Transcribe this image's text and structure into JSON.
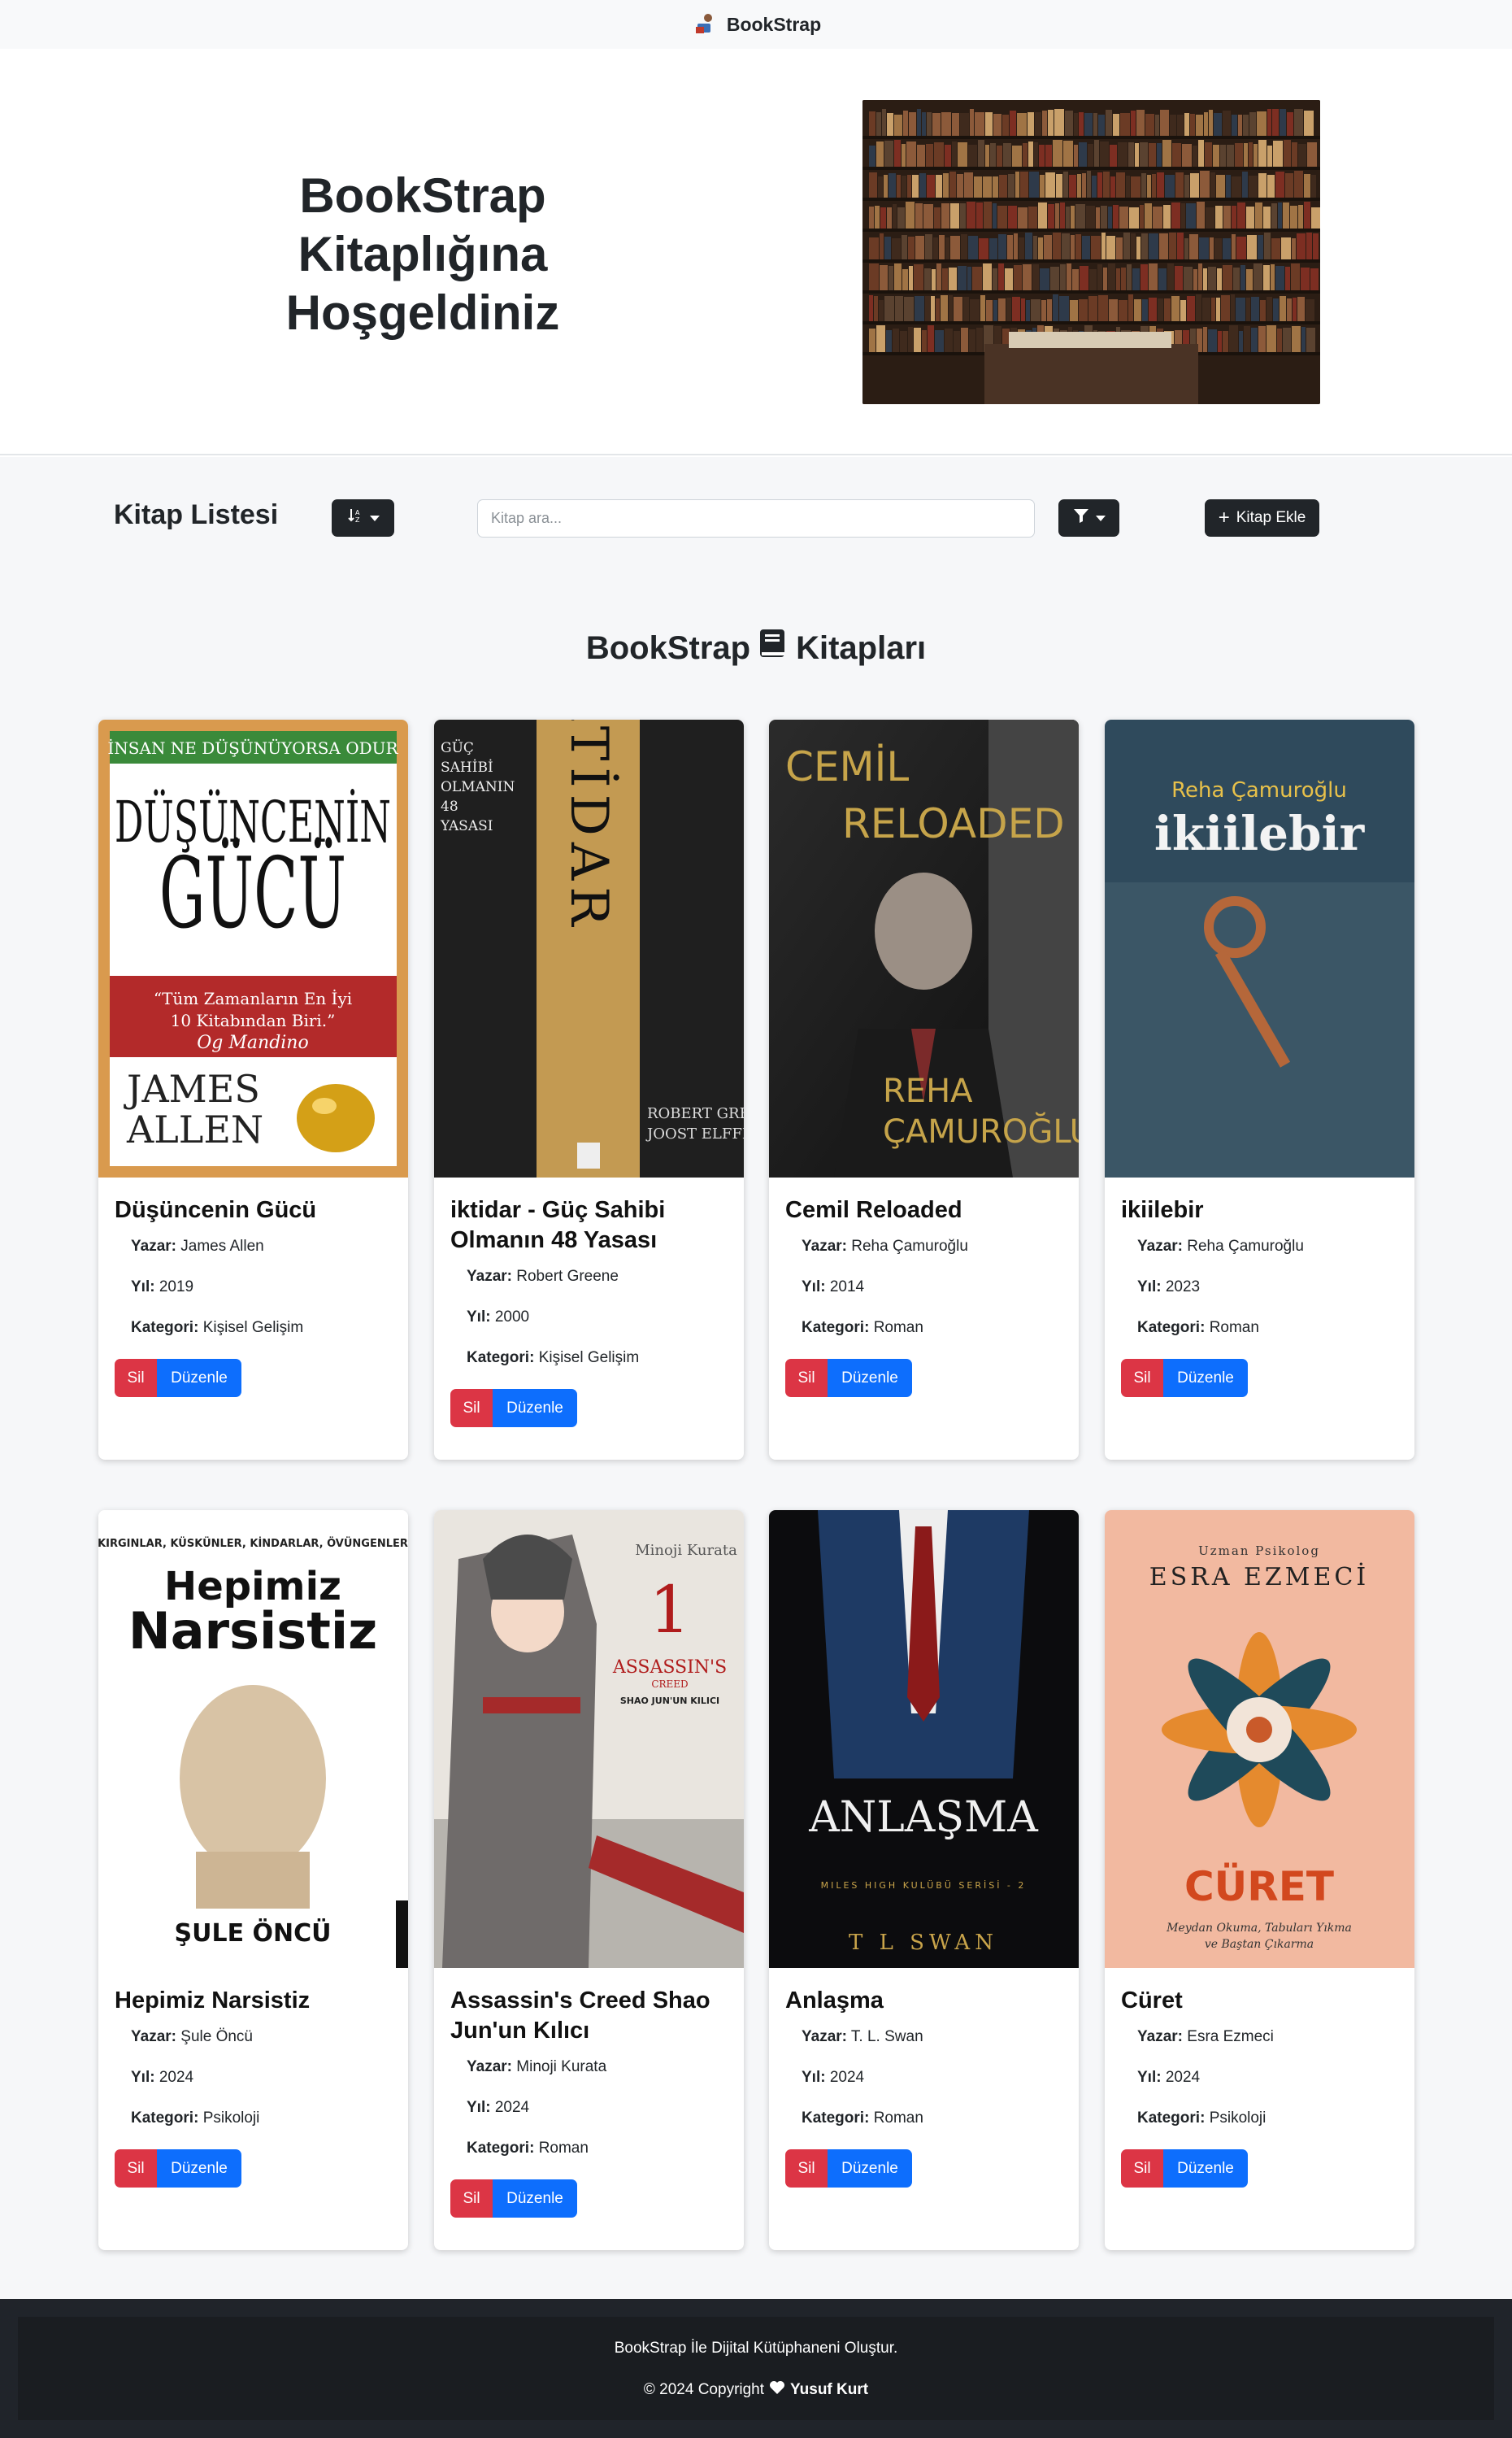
{
  "navbar": {
    "brand": "BookStrap",
    "brand_icon": "reading-person-icon"
  },
  "hero": {
    "title": "BookStrap Kitaplığına Hoşgeldiniz",
    "image": "bookshelf-photo"
  },
  "toolbar": {
    "title": "Kitap Listesi",
    "sort_icon": "sort-icon",
    "search_placeholder": "Kitap ara...",
    "filter_icon": "filter-icon",
    "add_label": "Kitap Ekle"
  },
  "section": {
    "title_left": "BookStrap",
    "title_right": "Kitapları",
    "icon": "book-icon"
  },
  "labels": {
    "author": "Yazar:",
    "year": "Yıl:",
    "category": "Kategori:",
    "delete": "Sil",
    "edit": "Düzenle"
  },
  "books": [
    {
      "title": "Düşüncenin Gücü",
      "author": "James Allen",
      "year": "2019",
      "category": "Kişisel Gelişim",
      "cover": {
        "top": "İNSAN NE DÜŞÜNÜYORSA ODUR",
        "main1": "DÜŞÜNCENİN",
        "main2": "GÜCÜ",
        "quote1": "“Tüm Zamanların En İyi",
        "quote2": "10 Kitabından Biri.”",
        "quote3": "Og Mandino",
        "author1": "JAMES",
        "author2": "ALLEN"
      }
    },
    {
      "title": "iktidar - Güç Sahibi Olmanın 48 Yasası",
      "author": "Robert Greene",
      "year": "2000",
      "category": "Kişisel Gelişim",
      "cover": {
        "side1": "GÜÇ",
        "side2": "SAHİBİ",
        "side3": "OLMANIN",
        "side4": "48",
        "side5": "YASASI",
        "main": "İKTİDAR",
        "author1": "ROBERT GREENE",
        "author2": "JOOST ELFFERS"
      }
    },
    {
      "title": "Cemil Reloaded",
      "author": "Reha Çamuroğlu",
      "year": "2014",
      "category": "Roman",
      "cover": {
        "t1": "CEMİL",
        "t2": "RELOADED",
        "a1": "REHA",
        "a2": "ÇAMUROĞLU"
      }
    },
    {
      "title": "ikiilebir",
      "author": "Reha Çamuroğlu",
      "year": "2023",
      "category": "Roman",
      "cover": {
        "author": "Reha Çamuroğlu",
        "main": "ikiilebir"
      }
    },
    {
      "title": "Hepimiz Narsistiz",
      "author": "Şule Öncü",
      "year": "2024",
      "category": "Psikoloji",
      "cover": {
        "top": "KIRGINLAR, KÜSKÜNLER, KİNDARLAR, ÖVÜNGENLER",
        "m1": "Hepimiz",
        "m2": "Narsistiz",
        "author": "ŞULE ÖNCÜ"
      }
    },
    {
      "title": "Assassin's Creed Shao Jun'un Kılıcı",
      "author": "Minoji Kurata",
      "year": "2024",
      "category": "Roman",
      "cover": {
        "author": "Minoji Kurata",
        "num": "1",
        "brand": "ASSASSIN'S",
        "brand2": "CREED",
        "sub": "SHAO JUN'UN KILICI"
      }
    },
    {
      "title": "Anlaşma",
      "author": "T. L. Swan",
      "year": "2024",
      "category": "Roman",
      "cover": {
        "main": "ANLAŞMA",
        "series": "MILES HIGH KULÜBÜ SERİSİ - 2",
        "author": "T L SWAN"
      }
    },
    {
      "title": "Cüret",
      "author": "Esra Ezmeci",
      "year": "2024",
      "category": "Psikoloji",
      "cover": {
        "pre": "Uzman Psikolog",
        "author": "ESRA EZMECİ",
        "main": "CÜRET",
        "sub1": "Meydan Okuma, Tabuları Yıkma",
        "sub2": "ve Baştan Çıkarma"
      }
    }
  ],
  "footer": {
    "line1": "BookStrap İle Dijital Kütüphaneni Oluştur.",
    "line2_pre": "© 2024 Copyright",
    "heart_icon": "heart-icon",
    "author": "Yusuf Kurt"
  }
}
